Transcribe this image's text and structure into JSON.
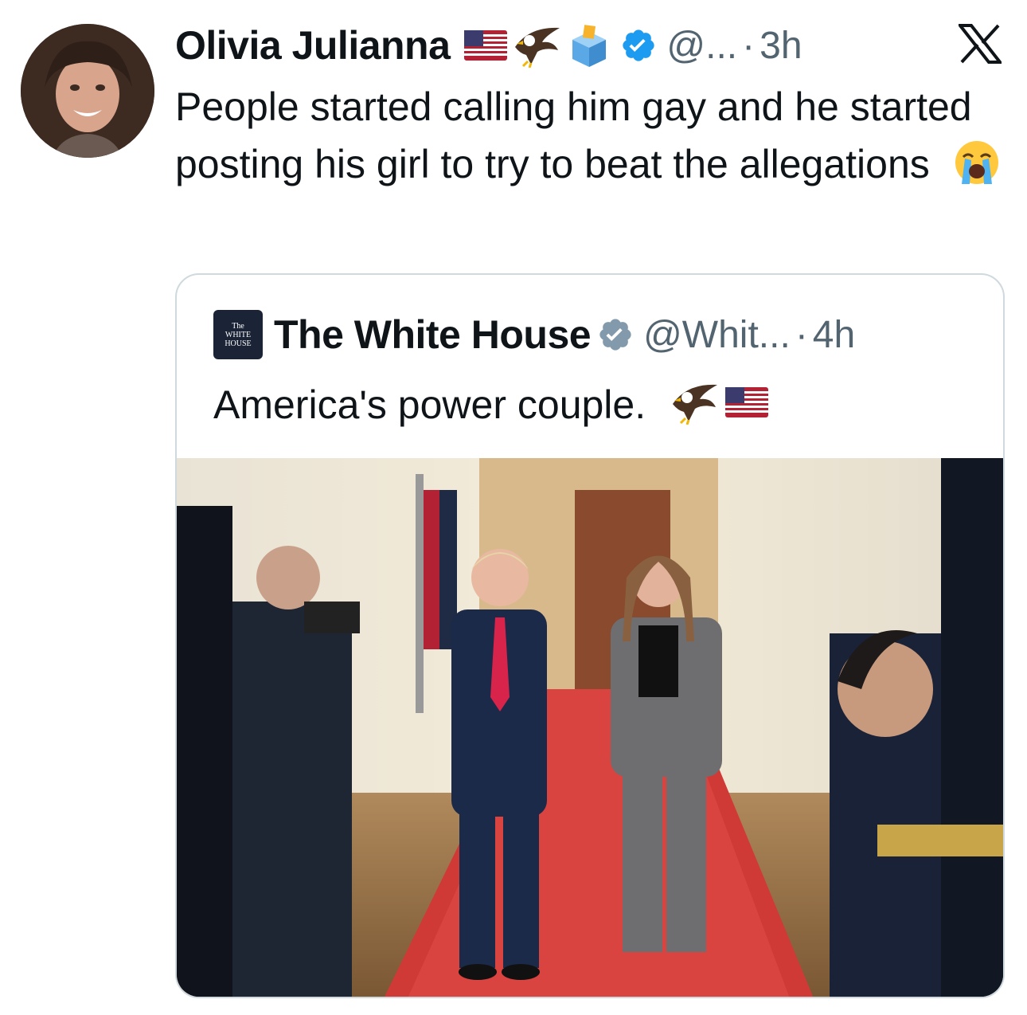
{
  "tweet": {
    "author": {
      "display_name": "Olivia Julianna",
      "handle": "@...",
      "avatar_icon": "profile-photo",
      "emoji": [
        "us-flag-icon",
        "eagle-icon",
        "ballot-box-icon"
      ],
      "verified_icon": "verified-badge-icon"
    },
    "separator": "·",
    "time": "3h",
    "text": "People started calling him gay and he started posting his girl to try to beat the allegations",
    "text_emoji": "loudly-crying-face-icon",
    "platform_icon": "x-logo-icon"
  },
  "quoted_tweet": {
    "author": {
      "display_name": "The White House",
      "handle": "@Whit...",
      "logo_icon": "white-house-logo",
      "verified_icon": "verified-badge-icon"
    },
    "separator": "·",
    "time": "4h",
    "text": "America's power couple.",
    "text_emoji": [
      "eagle-icon",
      "us-flag-icon"
    ],
    "media": {
      "type": "photo"
    }
  },
  "colors": {
    "text": "#0f1419",
    "secondary_text": "#536471",
    "verified_blue": "#1d9bf0",
    "border": "#cfd9de"
  }
}
